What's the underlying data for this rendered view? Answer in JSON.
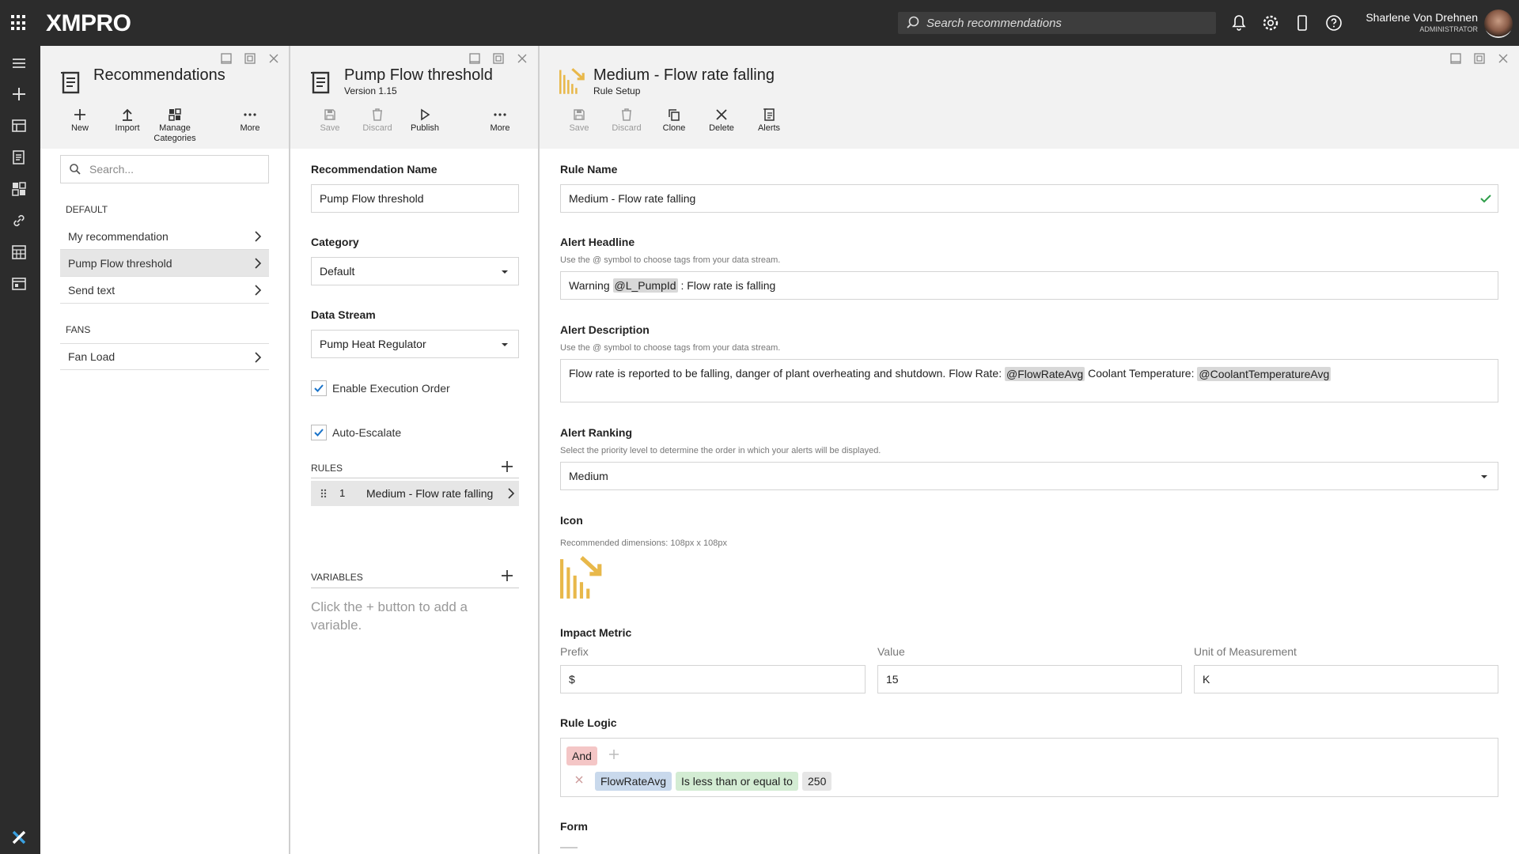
{
  "app": {
    "logo": "XMPRO",
    "search_placeholder": "Search recommendations",
    "user_name": "Sharlene Von Drehnen",
    "user_role": "ADMINISTRATOR"
  },
  "colors": {
    "topbar": "#2c2c2c",
    "accent_icon": "#e8b84a",
    "and_chip": "#f4c6c6",
    "field_chip": "#c9d9ec",
    "op_chip": "#d3ecd3",
    "value_chip": "#e6e6e6",
    "valid_check": "#2e9e4a"
  },
  "recommendations": {
    "title": "Recommendations",
    "toolbar": {
      "new": "New",
      "import": "Import",
      "manage": "Manage Categories",
      "more": "More"
    },
    "search_placeholder": "Search...",
    "groups": [
      {
        "name": "DEFAULT",
        "items": [
          "My recommendation",
          "Pump Flow threshold",
          "Send text"
        ]
      },
      {
        "name": "FANS",
        "items": [
          "Fan Load"
        ]
      }
    ]
  },
  "pump": {
    "title": "Pump Flow threshold",
    "version": "Version 1.15",
    "toolbar": {
      "save": "Save",
      "discard": "Discard",
      "publish": "Publish",
      "more": "More"
    },
    "name_label": "Recommendation Name",
    "name_value": "Pump Flow threshold",
    "category_label": "Category",
    "category_value": "Default",
    "stream_label": "Data Stream",
    "stream_value": "Pump Heat Regulator",
    "exec_order": "Enable Execution Order",
    "auto_escalate": "Auto-Escalate",
    "rules_label": "RULES",
    "rule_index": "1",
    "rule_name": "Medium - Flow rate falling",
    "variables_label": "VARIABLES",
    "variables_empty": "Click the + button to add a variable."
  },
  "rule": {
    "title": "Medium - Flow rate falling",
    "subtitle": "Rule Setup",
    "toolbar": {
      "save": "Save",
      "discard": "Discard",
      "clone": "Clone",
      "delete": "Delete",
      "alerts": "Alerts"
    },
    "rule_name_label": "Rule Name",
    "rule_name_value": "Medium - Flow rate falling",
    "headline_label": "Alert Headline",
    "headline_hint": "Use the @ symbol to choose tags from your data stream.",
    "headline_pre": "Warning",
    "headline_tag": "@L_PumpId",
    "headline_post": ": Flow rate is falling",
    "desc_label": "Alert Description",
    "desc_hint": "Use the @ symbol to choose tags from your data stream.",
    "desc_text1": "Flow rate is reported to be falling, danger of plant overheating and shutdown. Flow Rate:",
    "desc_tag1": "@FlowRateAvg",
    "desc_text2": "Coolant Temperature:",
    "desc_tag2": "@CoolantTemperatureAvg",
    "ranking_label": "Alert Ranking",
    "ranking_hint": "Select the priority level to determine the order in which your alerts will be displayed.",
    "ranking_value": "Medium",
    "icon_label": "Icon",
    "icon_hint": "Recommended dimensions: 108px x 108px",
    "impact_label": "Impact Metric",
    "prefix_label": "Prefix",
    "prefix_value": "$",
    "value_label": "Value",
    "value_value": "15",
    "unit_label": "Unit of Measurement",
    "unit_value": "K",
    "logic_label": "Rule Logic",
    "logic_and": "And",
    "logic_field": "FlowRateAvg",
    "logic_op": "Is less than or equal to",
    "logic_value": "250",
    "form_label": "Form"
  }
}
